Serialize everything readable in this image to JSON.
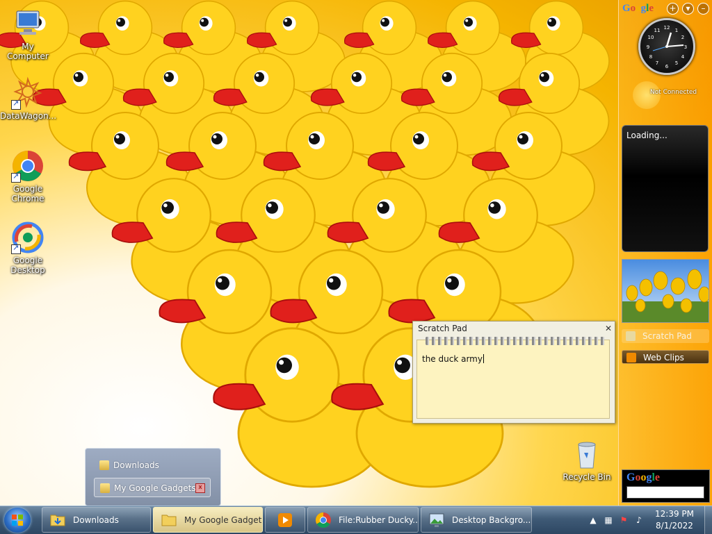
{
  "desktop": {
    "icons": [
      {
        "label": "My Computer",
        "icon": "computer-icon"
      },
      {
        "label": "DataWagon...",
        "icon": "datawagon-icon"
      },
      {
        "label": "Google Chrome",
        "icon": "chrome-icon"
      },
      {
        "label": "Google Desktop",
        "icon": "google-desktop-icon"
      }
    ],
    "recycle_bin": "Recycle Bin"
  },
  "sidebar": {
    "logo": "Google",
    "buttons": [
      "+",
      "▾",
      "–"
    ],
    "weather_status": "Not Connected",
    "news_loading": "Loading...",
    "items": [
      {
        "label": "Scratch Pad",
        "icon": "scratchpad-icon"
      },
      {
        "label": "Web Clips",
        "icon": "rss-icon"
      }
    ],
    "search_logo": "Google",
    "search_value": ""
  },
  "scratchpad": {
    "title": "Scratch Pad",
    "close": "✕",
    "text": "the duck army"
  },
  "jumplist": {
    "items": [
      {
        "label": "Downloads"
      },
      {
        "label": "My Google Gadgets",
        "close": "x"
      }
    ]
  },
  "taskbar": {
    "buttons": [
      {
        "label": "Downloads",
        "icon": "folder-icon"
      },
      {
        "label": "My Google Gadgets",
        "icon": "folder-icon",
        "active": true
      },
      {
        "label": "",
        "icon": "media-player-icon"
      },
      {
        "label": "File:Rubber Ducky...",
        "icon": "chrome-icon"
      },
      {
        "label": "Desktop Backgro...",
        "icon": "desktop-background-icon"
      }
    ],
    "tray": {
      "time": "12:39 PM",
      "date": "8/1/2022",
      "icons": [
        "show-hidden-icon",
        "network-icon",
        "action-center-icon",
        "volume-icon"
      ]
    }
  },
  "colors": {
    "accent_orange": "#f5b400",
    "duck_yellow": "#ffd21f",
    "beak_red": "#e0201c",
    "taskbar": "#3f5a76"
  }
}
